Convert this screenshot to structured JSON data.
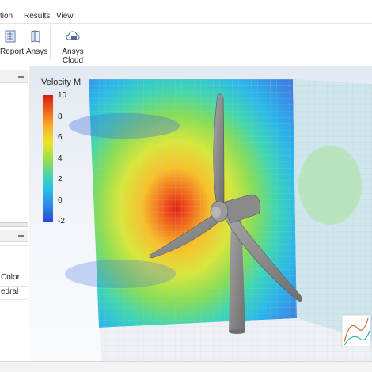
{
  "menu": {
    "items": [
      "tion",
      "Results",
      "View"
    ]
  },
  "ribbon": {
    "buttons": [
      {
        "label": "Report",
        "icon": "report-icon"
      },
      {
        "label": "Ansys",
        "icon": "ansys-book-icon"
      },
      {
        "label": "Ansys Cloud",
        "icon": "cloud-icon"
      }
    ]
  },
  "properties": {
    "rows": [
      "Color",
      "edral"
    ]
  },
  "legend": {
    "title": "Velocity M",
    "ticks": [
      "10",
      "8",
      "6",
      "4",
      "2",
      "0",
      "-2"
    ]
  },
  "colors": {
    "accent": "#1e6fc8",
    "turbine": "#8e8e8e",
    "hot": "#d8191a",
    "cold": "#2646d8"
  }
}
